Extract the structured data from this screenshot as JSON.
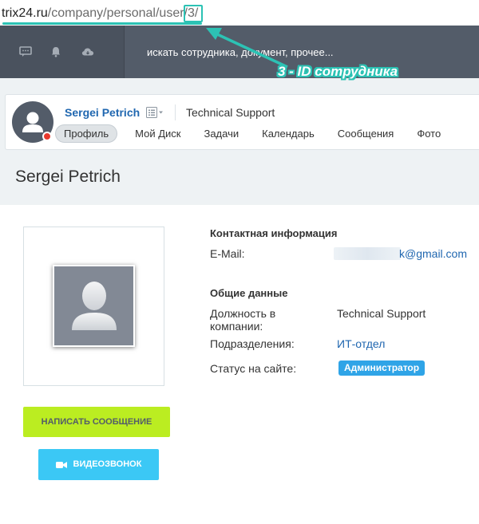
{
  "url": {
    "host": "trix24.ru",
    "path": "/company/personal/user/",
    "id": "3/"
  },
  "annotation": "3 - ID сотрудника",
  "topbar": {
    "search_placeholder": "искать сотрудника, документ, прочее...",
    "icons": [
      "chat-icon",
      "bell-icon",
      "cloud-icon"
    ]
  },
  "header": {
    "user_name": "Sergei Petrich",
    "department": "Technical Support",
    "tabs": [
      "Профиль",
      "Мой Диск",
      "Задачи",
      "Календарь",
      "Сообщения",
      "Фото"
    ],
    "active_tab": "Профиль"
  },
  "page_title": "Sergei Petrich",
  "actions": {
    "message_label": "НАПИСАТЬ СООБЩЕНИЕ",
    "video_label": "ВИДЕОЗВОНОК"
  },
  "contact": {
    "title": "Контактная информация",
    "email_label": "E-Mail:",
    "email_value": "k@gmail.com"
  },
  "general": {
    "title": "Общие данные",
    "position_label": "Должность в компании:",
    "position_value": "Technical Support",
    "department_label": "Подразделения:",
    "department_value": "ИТ-отдел",
    "status_label": "Статус на сайте:",
    "status_value": "Администратор"
  },
  "colors": {
    "accent_teal": "#2cc2b4",
    "topbar": "#535c69",
    "message_button": "#bbed21",
    "video_button": "#3bc8f5",
    "link": "#2067b0",
    "badge": "#2fa4e7"
  }
}
